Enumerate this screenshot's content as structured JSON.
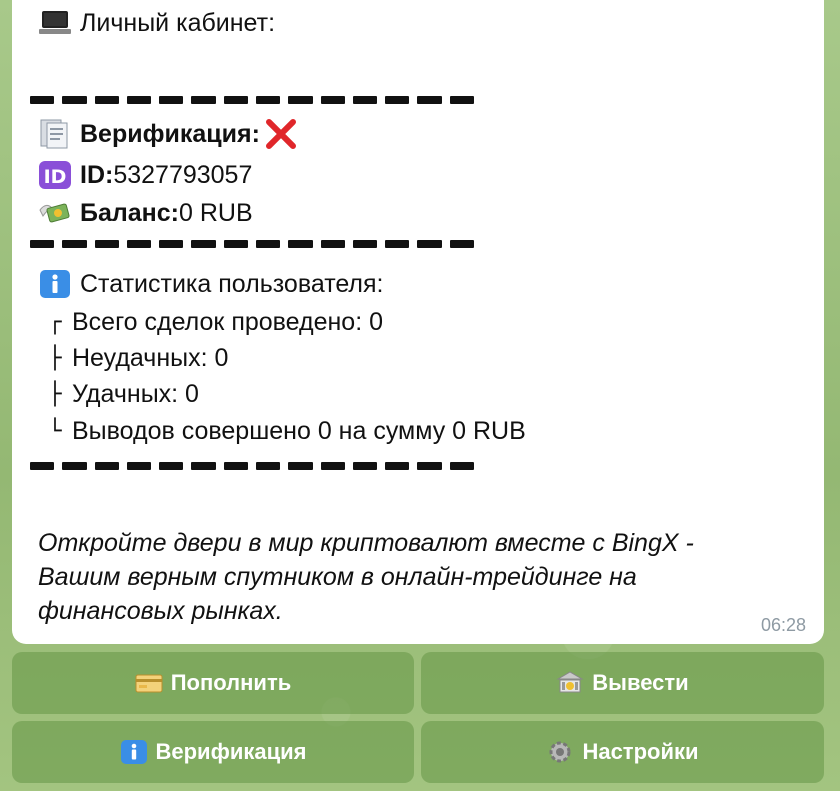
{
  "message": {
    "header": "Личный кабинет:",
    "verification_label": "Верификация:",
    "id_label": "ID:",
    "id_value": " 5327793057",
    "balance_label": "Баланс:",
    "balance_value": " 0 RUB",
    "stats_title": "Статистика пользователя:",
    "stats": [
      {
        "branch": "┌",
        "text": "Всего сделок проведено: 0"
      },
      {
        "branch": "├",
        "text": "Неудачных: 0"
      },
      {
        "branch": "├",
        "text": "Удачных: 0"
      },
      {
        "branch": "└",
        "text": "Выводов совершено 0 на сумму 0 RUB"
      }
    ],
    "footer_text": "Откройте двери в мир криптовалют вместе с BingX - Вашим верным спутником в онлайн-трейдинге на финансовых рынках.",
    "time": "06:28"
  },
  "keyboard": {
    "deposit": "Пополнить",
    "withdraw": "Вывести",
    "verification": "Верификация",
    "settings": "Настройки"
  },
  "icons": {
    "header": "laptop-icon",
    "verification": "document-icon",
    "verification_status": "red-cross-icon",
    "id": "id-badge-icon",
    "balance": "money-wings-icon",
    "stats": "info-icon",
    "deposit": "credit-card-icon",
    "withdraw": "bank-icon",
    "verify_button": "info-icon",
    "settings": "gear-icon"
  },
  "colors": {
    "accent_red": "#e0262a",
    "id_purple": "#8a4fd8",
    "info_blue": "#3a8ee6"
  }
}
